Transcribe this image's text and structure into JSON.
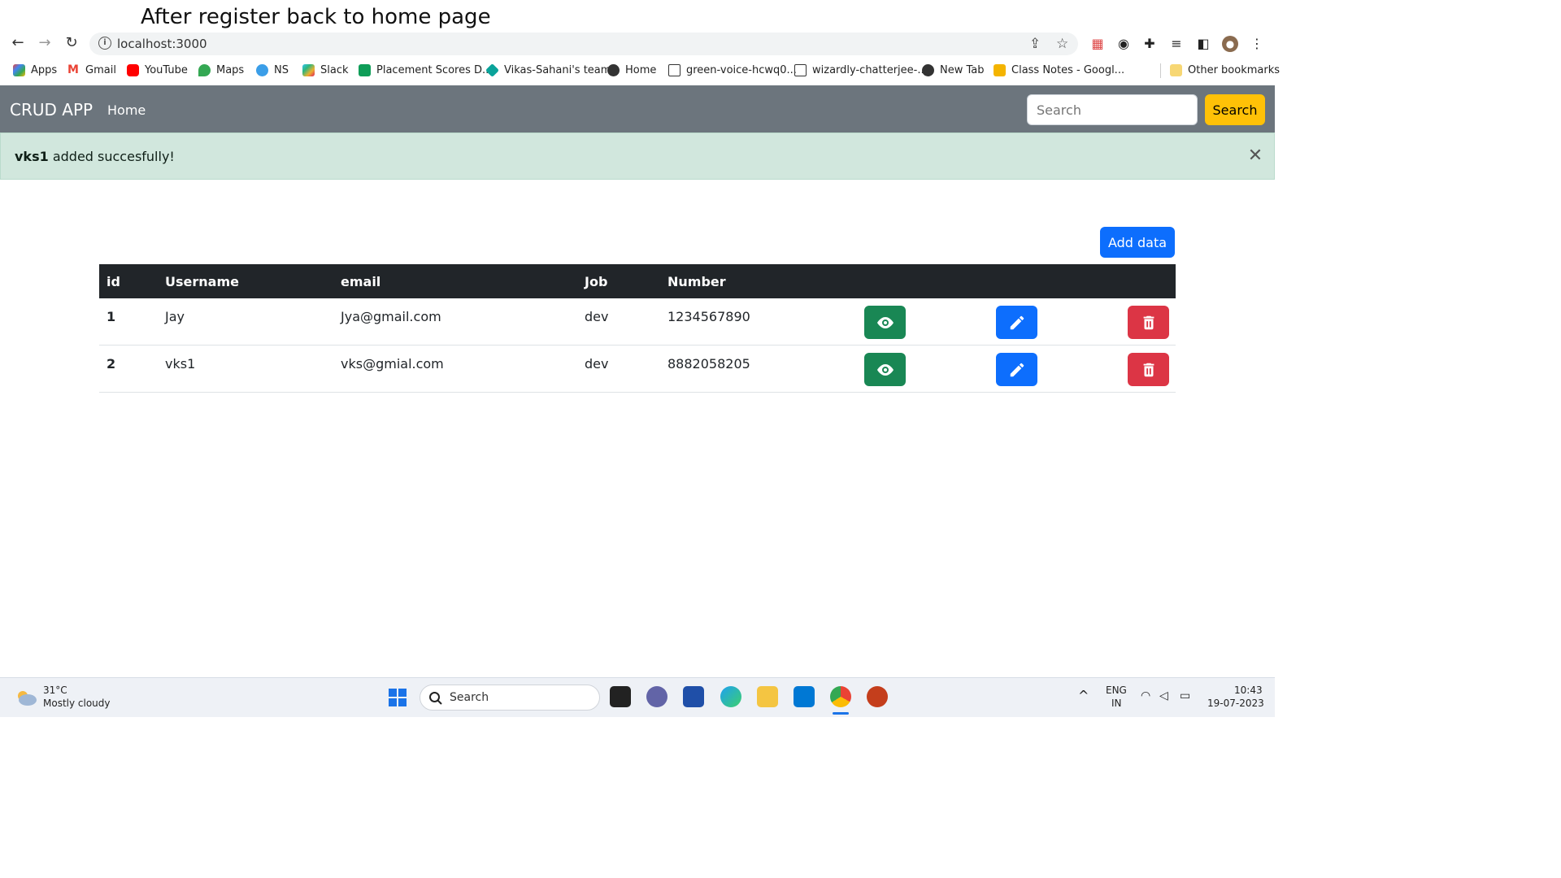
{
  "caption": "After register back to home page",
  "browser": {
    "url": "localhost:3000",
    "bookmarks": [
      {
        "label": "Apps",
        "color": "#4285f4"
      },
      {
        "label": "Gmail",
        "color": "#ea4335"
      },
      {
        "label": "YouTube",
        "color": "#ff0000"
      },
      {
        "label": "Maps",
        "color": "#34a853"
      },
      {
        "label": "NS",
        "color": "#3b9ee8"
      },
      {
        "label": "Slack",
        "color": "#4a154b"
      },
      {
        "label": "Placement Scores D...",
        "color": "#0f9d58"
      },
      {
        "label": "Vikas-Sahani's team",
        "color": "#0aa39a"
      },
      {
        "label": "Home",
        "color": "#333333"
      },
      {
        "label": "green-voice-hcwq0...",
        "color": "#ffffff"
      },
      {
        "label": "wizardly-chatterjee-...",
        "color": "#ffffff"
      },
      {
        "label": "New Tab",
        "color": "#333333"
      },
      {
        "label": "Class Notes - Googl...",
        "color": "#f4b400"
      },
      {
        "label": "Other bookmarks",
        "color": "#f7d774"
      }
    ]
  },
  "navbar": {
    "brand": "CRUD APP",
    "home": "Home",
    "search_placeholder": "Search",
    "search_button": "Search"
  },
  "alert": {
    "name": "vks1",
    "message": " added succesfully!"
  },
  "add_button": "Add data",
  "table": {
    "headers": {
      "id": "id",
      "username": "Username",
      "email": "email",
      "job": "Job",
      "number": "Number"
    },
    "rows": [
      {
        "id": "1",
        "username": "Jay",
        "email": "Jya@gmail.com",
        "job": "dev",
        "number": "1234567890"
      },
      {
        "id": "2",
        "username": "vks1",
        "email": "vks@gmial.com",
        "job": "dev",
        "number": "8882058205"
      }
    ]
  },
  "taskbar": {
    "temperature": "31°C",
    "weather": "Mostly cloudy",
    "search": "Search",
    "lang1": "ENG",
    "lang2": "IN",
    "time": "10:43",
    "date": "19-07-2023"
  },
  "colors": {
    "navbar": "#6c757d",
    "alert_bg": "#d1e7dd",
    "view": "#198754",
    "edit": "#0d6efd",
    "delete": "#dc3545",
    "search_btn": "#ffc107"
  }
}
